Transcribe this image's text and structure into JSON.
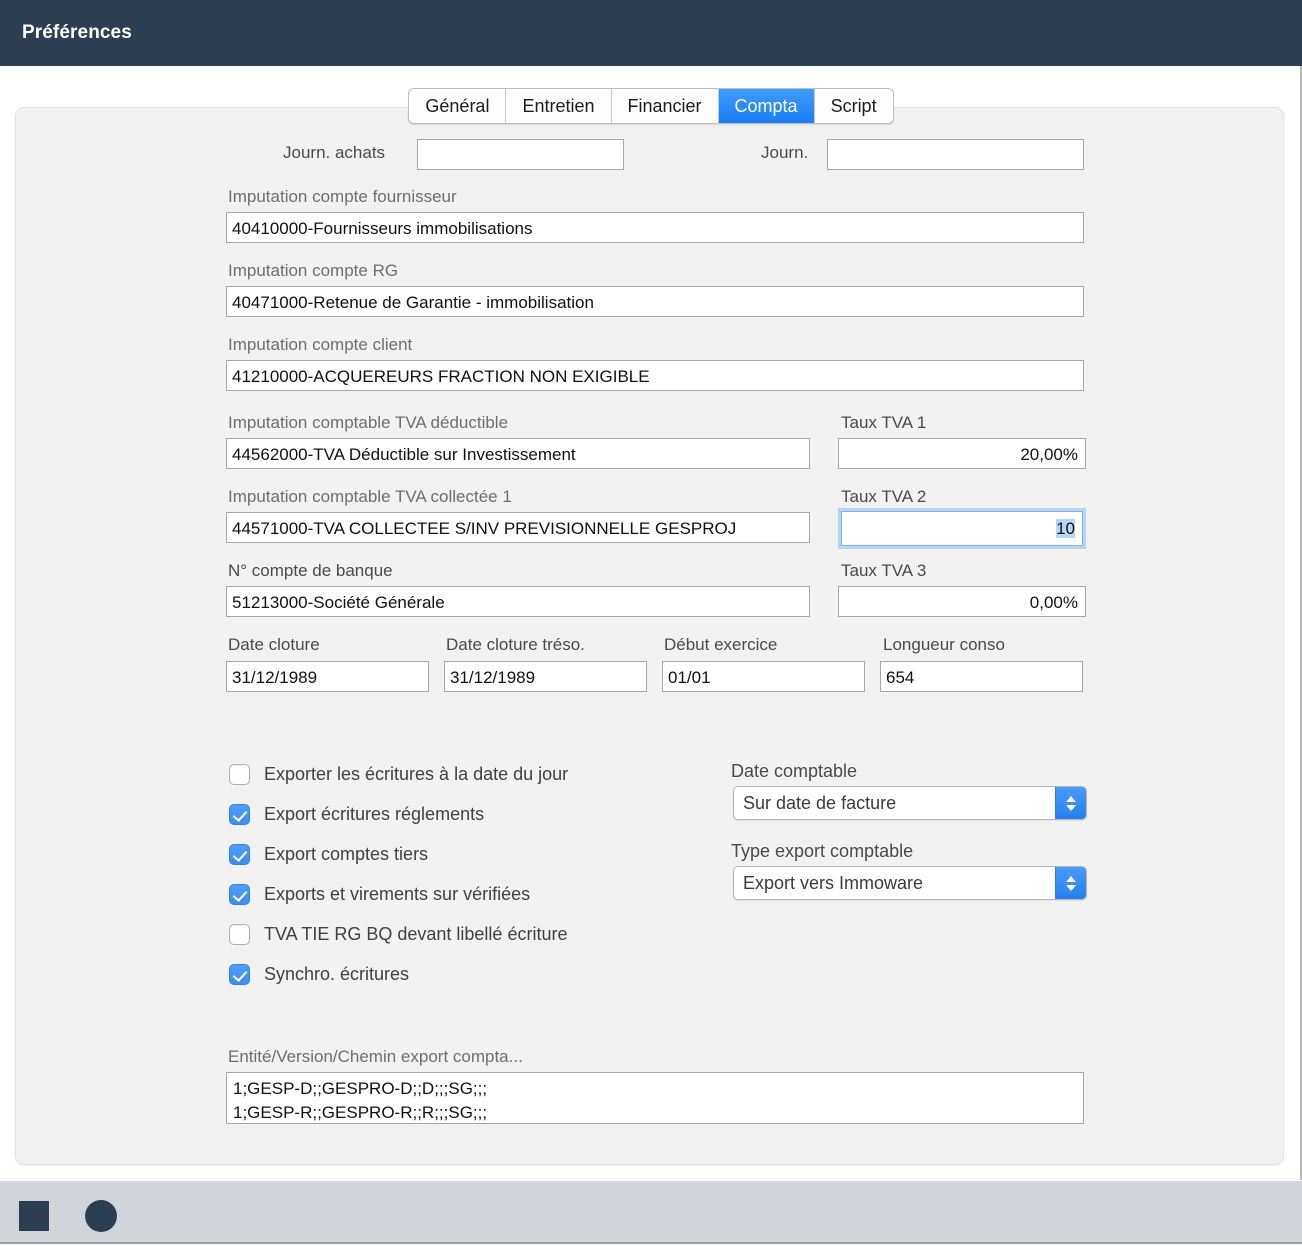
{
  "window": {
    "title": "Préférences"
  },
  "tabs": [
    {
      "label": "Général",
      "active": false
    },
    {
      "label": "Entretien",
      "active": false
    },
    {
      "label": "Financier",
      "active": false
    },
    {
      "label": "Compta",
      "active": true
    },
    {
      "label": "Script",
      "active": false
    }
  ],
  "form": {
    "journ_achats_label": "Journ. achats",
    "journ_achats_value": "",
    "journ_label": "Journ.",
    "journ_value": "",
    "imput_fournisseur_label": "Imputation compte fournisseur",
    "imput_fournisseur_value": "40410000-Fournisseurs immobilisations",
    "imput_rg_label": "Imputation compte RG",
    "imput_rg_value": "40471000-Retenue de Garantie - immobilisation",
    "imput_client_label": "Imputation compte client",
    "imput_client_value": "41210000-ACQUEREURS FRACTION NON EXIGIBLE",
    "tva_deductible_label": "Imputation comptable TVA déductible",
    "tva_deductible_value": "44562000-TVA Déductible sur Investissement",
    "tva_collectee_label": "Imputation comptable TVA collectée 1",
    "tva_collectee_value": "44571000-TVA COLLECTEE S/INV PREVISIONNELLE GESPROJ",
    "compte_banque_label": "N° compte de banque",
    "compte_banque_value": "51213000-Société Générale",
    "taux_tva1_label": "Taux TVA 1",
    "taux_tva1_value": "20,00%",
    "taux_tva2_label": "Taux TVA 2",
    "taux_tva2_value": "10",
    "taux_tva3_label": "Taux TVA 3",
    "taux_tva3_value": "0,00%",
    "date_cloture_label": "Date cloture",
    "date_cloture_value": "31/12/1989",
    "date_cloture_treso_label": "Date cloture tréso.",
    "date_cloture_treso_value": "31/12/1989",
    "debut_exercice_label": "Début exercice",
    "debut_exercice_value": "01/01",
    "longueur_conso_label": "Longueur conso",
    "longueur_conso_value": "654"
  },
  "checkboxes": [
    {
      "label": "Exporter les écritures à la date du jour",
      "checked": false
    },
    {
      "label": "Export écritures réglements",
      "checked": true
    },
    {
      "label": "Export comptes tiers",
      "checked": true
    },
    {
      "label": "Exports et virements sur vérifiées",
      "checked": true
    },
    {
      "label": "TVA TIE RG BQ devant libellé écriture",
      "checked": false
    },
    {
      "label": "Synchro. écritures",
      "checked": true
    }
  ],
  "selects": {
    "date_comptable_label": "Date comptable",
    "date_comptable_value": "Sur date de facture",
    "type_export_label": "Type export comptable",
    "type_export_value": "Export vers Immoware"
  },
  "export_path": {
    "label": "Entité/Version/Chemin export compta...",
    "value": "1;GESP-D;;GESPRO-D;;D;;;SG;;;\n1;GESP-R;;GESPRO-R;;R;;;SG;;;"
  },
  "bottombar": {
    "stop_icon": "stop-square-icon",
    "record_icon": "record-circle-icon"
  },
  "colors": {
    "titlebar": "#2d3e50",
    "accent": "#2580ee",
    "panel": "#f2f2f2",
    "toolbar": "#d1d5db"
  }
}
